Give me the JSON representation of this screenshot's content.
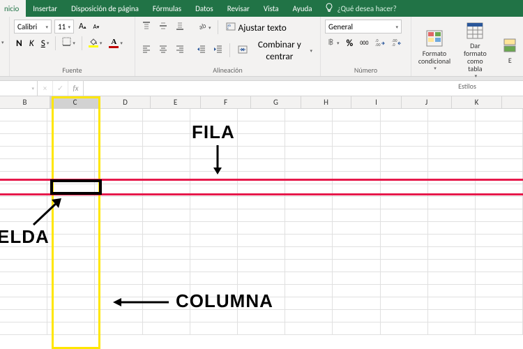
{
  "ribbon": {
    "tabs": {
      "inicio": "nicio",
      "insertar": "Insertar",
      "disposicion": "Disposición de página",
      "formulas": "Fórmulas",
      "datos": "Datos",
      "revisar": "Revisar",
      "vista": "Vista",
      "ayuda": "Ayuda"
    },
    "tell_me_placeholder": "¿Qué desea hacer?",
    "font": {
      "name": "Calibri",
      "size": "11",
      "group_label": "Fuente",
      "bold": "N",
      "italic": "K",
      "underline": "S",
      "increase_a": "A",
      "decrease_a": "A"
    },
    "alignment": {
      "group_label": "Alineación",
      "wrap_text": "Ajustar texto",
      "merge_center": "Combinar y centrar"
    },
    "number": {
      "group_label": "Número",
      "format_value": "General",
      "currency": "",
      "percent": "%",
      "comma": "000",
      "inc_dec_icon_left": "←0",
      "inc_dec_icon_right": "0→"
    },
    "styles": {
      "group_label": "Estilos",
      "conditional_label": "Formato\ncondicional",
      "table_label": "Dar formato\ncomo tabla",
      "cell_styles_partial": "E"
    }
  },
  "formula_bar": {
    "name_box": "",
    "fx": "fx",
    "cancel": "×",
    "enter": "✓",
    "formula_value": ""
  },
  "grid": {
    "columns": [
      "B",
      "C",
      "D",
      "E",
      "F",
      "G",
      "H",
      "I",
      "J",
      "K"
    ],
    "visible_rows": 18
  },
  "annotations": {
    "fila": "FILA",
    "columna": "COLUMNA",
    "celda": "ELDA"
  },
  "colors": {
    "excel_green": "#217346",
    "highlight_yellow": "#ffe600",
    "highlight_red": "#e6194b",
    "font_fill_yellow": "#ffff00",
    "font_color_red": "#c00000"
  }
}
